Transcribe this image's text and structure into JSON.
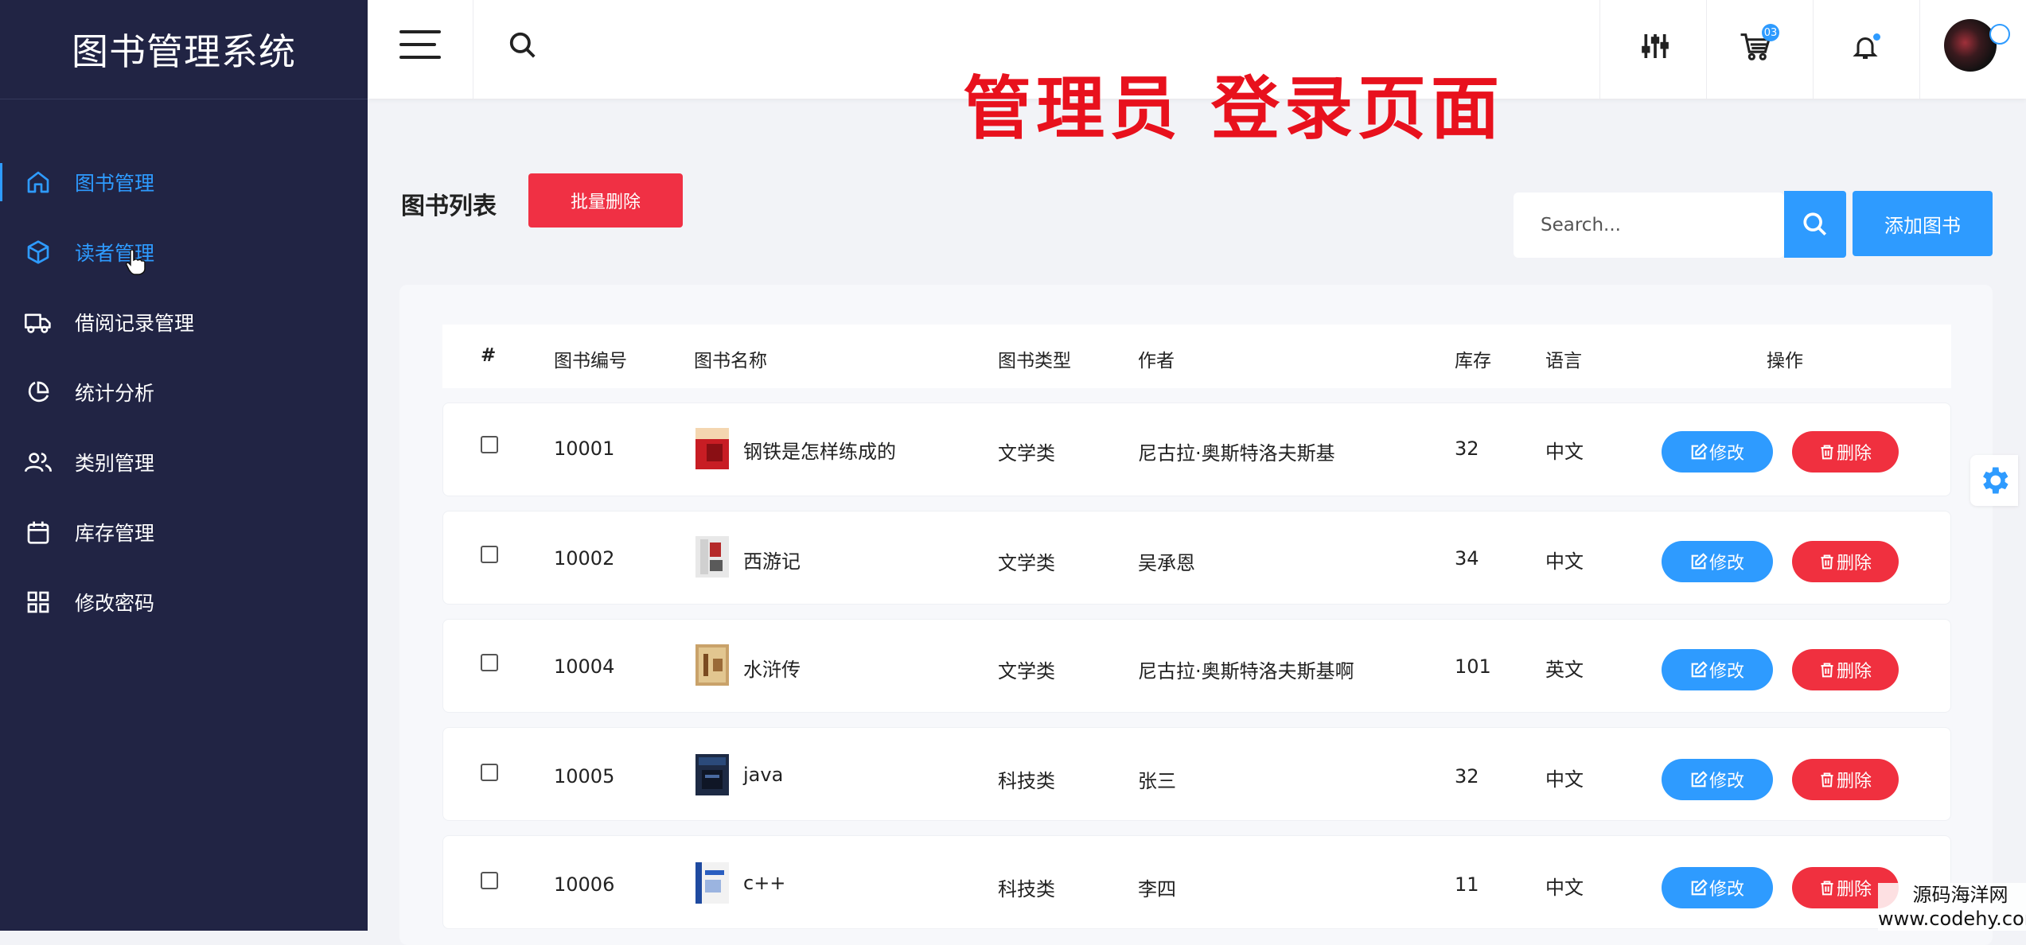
{
  "app": {
    "title": "图书管理系统"
  },
  "sidebar": {
    "items": [
      {
        "label": "图书管理",
        "icon": "home-icon",
        "active": true
      },
      {
        "label": "读者管理",
        "icon": "cube-icon",
        "hover": true
      },
      {
        "label": "借阅记录管理",
        "icon": "truck-icon"
      },
      {
        "label": "统计分析",
        "icon": "pie-chart-icon"
      },
      {
        "label": "类别管理",
        "icon": "users-icon"
      },
      {
        "label": "库存管理",
        "icon": "calendar-icon"
      },
      {
        "label": "修改密码",
        "icon": "grid-icon"
      }
    ]
  },
  "topbar": {
    "overlay_title": "管理员 登录页面",
    "cart_badge": "03",
    "icons": [
      "menu-icon",
      "search-icon",
      "sliders-icon",
      "cart-icon",
      "bell-icon",
      "avatar"
    ]
  },
  "content": {
    "list_title": "图书列表",
    "batch_delete_label": "批量删除",
    "search_placeholder": "Search...",
    "add_book_label": "添加图书"
  },
  "table": {
    "headers": [
      "#",
      "图书编号",
      "图书名称",
      "图书类型",
      "作者",
      "库存",
      "语言",
      "操作"
    ],
    "edit_label": "修改",
    "delete_label": "删除",
    "rows": [
      {
        "id": "10001",
        "name": "钢铁是怎样练成的",
        "type": "文学类",
        "author": "尼古拉·奥斯特洛夫斯基",
        "stock": "32",
        "lang": "中文"
      },
      {
        "id": "10002",
        "name": "西游记",
        "type": "文学类",
        "author": "吴承恩",
        "stock": "34",
        "lang": "中文"
      },
      {
        "id": "10004",
        "name": "水浒传",
        "type": "文学类",
        "author": "尼古拉·奥斯特洛夫斯基啊",
        "stock": "101",
        "lang": "英文"
      },
      {
        "id": "10005",
        "name": "java",
        "type": "科技类",
        "author": "张三",
        "stock": "32",
        "lang": "中文"
      },
      {
        "id": "10006",
        "name": "c++",
        "type": "科技类",
        "author": "李四",
        "stock": "11",
        "lang": "中文"
      }
    ]
  },
  "watermark": {
    "line1": "源码海洋网",
    "line2": "www.codehy.com"
  },
  "colors": {
    "sidebar": "#212444",
    "accent": "#2e9bff",
    "danger": "#f0303f",
    "title_red": "#e8111d"
  }
}
